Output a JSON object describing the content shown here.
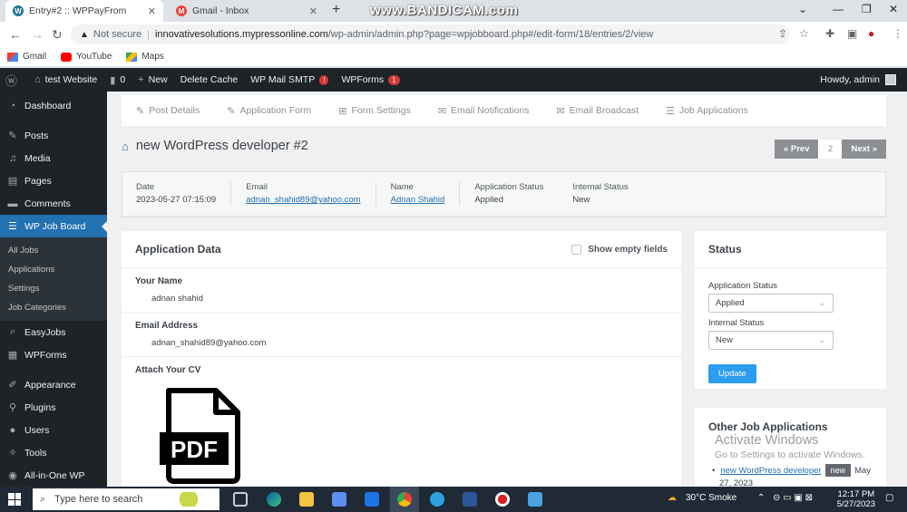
{
  "browser": {
    "tabs": [
      {
        "title": "Entry#2 :: WPPayFrom",
        "active": true
      },
      {
        "title": "Gmail - Inbox",
        "active": false
      }
    ],
    "watermark": "www.BANDICAM.com",
    "address": {
      "security": "Not secure",
      "url_host": "innovativesolutions.mypressonline.com",
      "url_path": "/wp-admin/admin.php?page=wpjobboard.php#/edit-form/18/entries/2/view"
    },
    "bookmarks": [
      "Gmail",
      "YouTube",
      "Maps"
    ]
  },
  "adminbar": {
    "site": "test Website",
    "comments_count": "0",
    "new_label": "New",
    "delete_cache": "Delete Cache",
    "mail_smtp": "WP Mail SMTP",
    "mail_smtp_badge": "!",
    "wpforms": "WPForms",
    "wpforms_badge": "1",
    "howdy": "Howdy, admin"
  },
  "sidebar": {
    "items": [
      {
        "label": "Dashboard",
        "icon": "dashboard-icon"
      },
      {
        "label": "Posts",
        "icon": "pin-icon"
      },
      {
        "label": "Media",
        "icon": "media-icon"
      },
      {
        "label": "Pages",
        "icon": "page-icon"
      },
      {
        "label": "Comments",
        "icon": "comment-icon"
      },
      {
        "label": "WP Job Board",
        "icon": "list-icon"
      }
    ],
    "submenu": [
      "All Jobs",
      "Applications",
      "Settings",
      "Job Categories"
    ],
    "items_after": [
      {
        "label": "EasyJobs",
        "icon": "search-icon"
      },
      {
        "label": "WPForms",
        "icon": "forms-icon"
      },
      {
        "label": "Appearance",
        "icon": "brush-icon"
      },
      {
        "label": "Plugins",
        "icon": "plugin-icon"
      },
      {
        "label": "Users",
        "icon": "user-icon"
      },
      {
        "label": "Tools",
        "icon": "wrench-icon"
      },
      {
        "label": "All-in-One WP",
        "icon": "migration-icon"
      }
    ]
  },
  "tabs": [
    "Post Details",
    "Application Form",
    "Form Settings",
    "Email Notifications",
    "Email Broadcast",
    "Job Applications"
  ],
  "page": {
    "title": "new WordPress developer #2",
    "prev": "« Prev",
    "page_number": "2",
    "next": "Next »"
  },
  "meta": {
    "date_label": "Date",
    "date_value": "2023-05-27 07:15:09",
    "email_label": "Email",
    "email_value": "adnan_shahid89@yahoo.com",
    "name_label": "Name",
    "name_value": "Adnan Shahid",
    "app_status_label": "Application Status",
    "app_status_value": "Applied",
    "internal_status_label": "Internal Status",
    "internal_status_value": "New"
  },
  "application": {
    "title": "Application Data",
    "show_empty": "Show empty fields",
    "fields": [
      {
        "label": "Your Name",
        "value": "adnan shahid"
      },
      {
        "label": "Email Address",
        "value": "adnan_shahid89@yahoo.com"
      }
    ],
    "cv_label": "Attach Your CV",
    "pdf_text": "PDF"
  },
  "status_panel": {
    "title": "Status",
    "app_status_label": "Application Status",
    "app_status_value": "Applied",
    "internal_status_label": "Internal Status",
    "internal_status_value": "New",
    "update": "Update"
  },
  "other_jobs": {
    "title": "Other Job Applications",
    "activate_title": "Activate Windows",
    "activate_sub": "Go to Settings to activate Windows.",
    "item_link": "new WordPress developer",
    "item_badge": "new",
    "item_date_a": "May",
    "item_date_b": "27, 2023"
  },
  "taskbar": {
    "search_placeholder": "Type here to search",
    "weather": "30°C  Smoke",
    "time": "12:17 PM",
    "date": "5/27/2023"
  }
}
